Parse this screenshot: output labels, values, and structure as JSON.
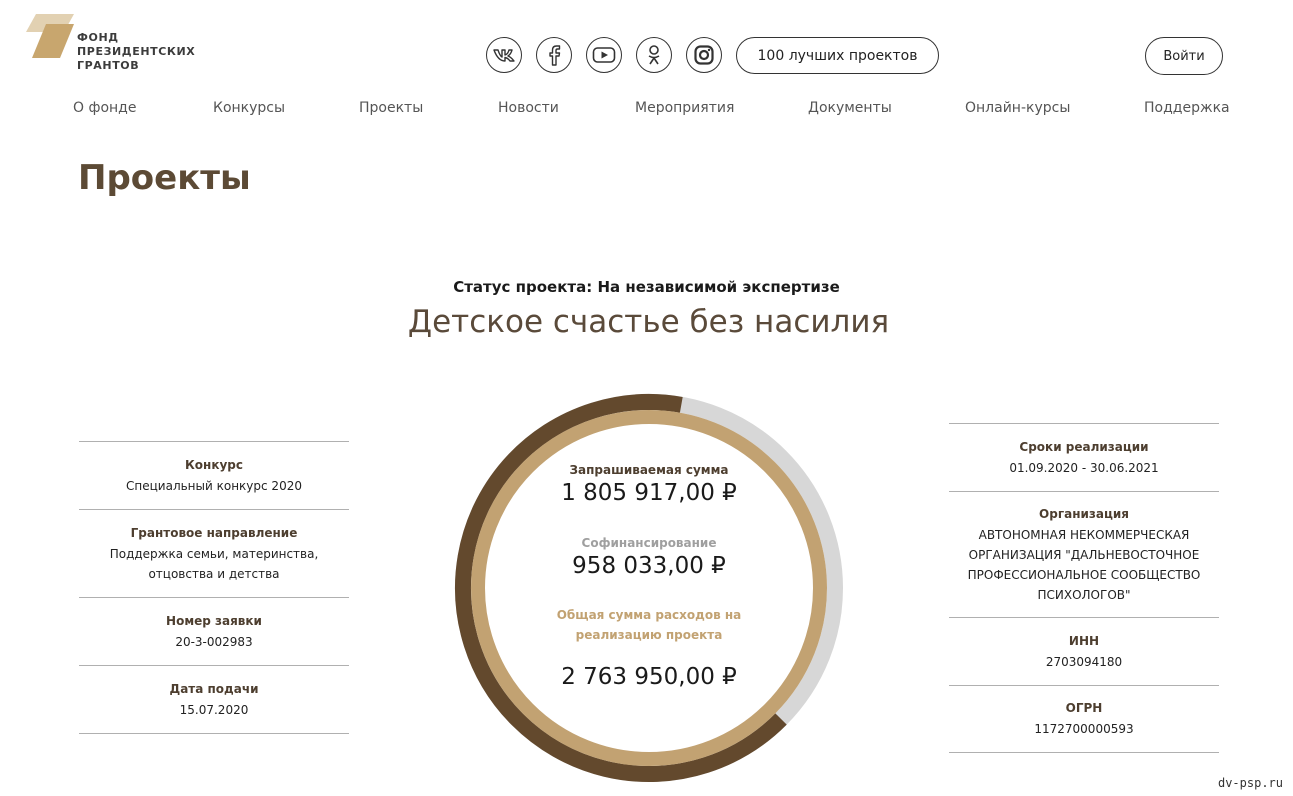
{
  "logo": {
    "lines": [
      "ФОНД",
      "ПРЕЗИДЕНТСКИХ",
      "ГРАНТОВ"
    ]
  },
  "social": [
    {
      "icon": "vk-icon"
    },
    {
      "icon": "facebook-icon"
    },
    {
      "icon": "youtube-icon"
    },
    {
      "icon": "odnoklassniki-icon"
    },
    {
      "icon": "instagram-icon"
    }
  ],
  "header": {
    "best_projects": "100 лучших проектов",
    "login": "Войти"
  },
  "nav": [
    "О фонде",
    "Конкурсы",
    "Проекты",
    "Новости",
    "Мероприятия",
    "Документы",
    "Онлайн-курсы",
    "Поддержка"
  ],
  "page_title": "Проекты",
  "status": "Статус проекта: На независимой экспертизе",
  "project_title": "Детское счастье без насилия",
  "left_info": [
    {
      "label": "Конкурс",
      "value": "Специальный конкурс 2020"
    },
    {
      "label": "Грантовое направление",
      "value": "Поддержка семьи, материнства, отцовства и детства"
    },
    {
      "label": "Номер заявки",
      "value": "20-3-002983"
    },
    {
      "label": "Дата подачи",
      "value": "15.07.2020"
    }
  ],
  "right_info": [
    {
      "label": "Сроки реализации",
      "value": "01.09.2020 - 30.06.2021"
    },
    {
      "label": "Организация",
      "value": "АВТОНОМНАЯ НЕКОММЕРЧЕСКАЯ ОРГАНИЗАЦИЯ \"ДАЛЬНЕВОСТОЧНОЕ ПРОФЕССИОНАЛЬНОЕ СООБЩЕСТВО ПСИХОЛОГОВ\""
    },
    {
      "label": "ИНН",
      "value": "2703094180"
    },
    {
      "label": "ОГРН",
      "value": "1172700000593"
    }
  ],
  "finance": {
    "requested_label": "Запрашиваемая сумма",
    "requested_value": "1 805 917,00 ₽",
    "cofinancing_label": "Софинансирование",
    "cofinancing_value": "958 033,00 ₽",
    "total_label": "Общая сумма расходов на реализацию проекта",
    "total_value": "2 763 950,00 ₽",
    "requested_share": 0.6534
  },
  "colors": {
    "dark": "#63492d",
    "light": "#c2a272",
    "grey": "#d7d7d7",
    "title": "#5c4a35"
  },
  "watermark": "dv-psp.ru"
}
